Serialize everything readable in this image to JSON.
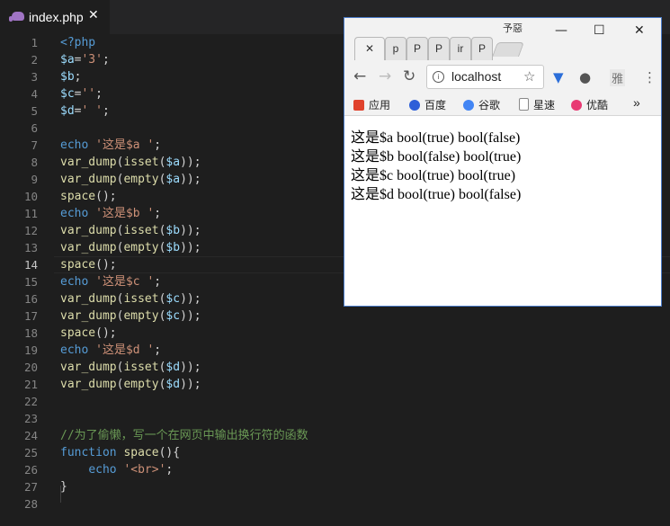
{
  "editor": {
    "tab": {
      "filename": "index.php",
      "close_glyph": "✕",
      "icon": "php-elephant-icon"
    },
    "current_line": 14,
    "lines": [
      {
        "n": "1",
        "t": [
          [
            "tag",
            "<?php"
          ]
        ]
      },
      {
        "n": "2",
        "t": [
          [
            "var",
            "$a"
          ],
          [
            "op",
            "="
          ],
          [
            "str",
            "'3'"
          ],
          [
            "op",
            ";"
          ]
        ]
      },
      {
        "n": "3",
        "t": [
          [
            "var",
            "$b"
          ],
          [
            "op",
            ";"
          ]
        ]
      },
      {
        "n": "4",
        "t": [
          [
            "var",
            "$c"
          ],
          [
            "op",
            "="
          ],
          [
            "str",
            "''"
          ],
          [
            "op",
            ";"
          ]
        ]
      },
      {
        "n": "5",
        "t": [
          [
            "var",
            "$d"
          ],
          [
            "op",
            "="
          ],
          [
            "str",
            "' '"
          ],
          [
            "op",
            ";"
          ]
        ]
      },
      {
        "n": "6",
        "t": []
      },
      {
        "n": "7",
        "t": [
          [
            "kw",
            "echo"
          ],
          [
            "plain",
            " "
          ],
          [
            "str",
            "'这是$a '"
          ],
          [
            "op",
            ";"
          ]
        ]
      },
      {
        "n": "8",
        "t": [
          [
            "fn",
            "var_dump"
          ],
          [
            "op",
            "("
          ],
          [
            "fn",
            "isset"
          ],
          [
            "op",
            "("
          ],
          [
            "var",
            "$a"
          ],
          [
            "op",
            "));"
          ]
        ]
      },
      {
        "n": "9",
        "t": [
          [
            "fn",
            "var_dump"
          ],
          [
            "op",
            "("
          ],
          [
            "fn",
            "empty"
          ],
          [
            "op",
            "("
          ],
          [
            "var",
            "$a"
          ],
          [
            "op",
            "));"
          ]
        ]
      },
      {
        "n": "10",
        "t": [
          [
            "fn",
            "space"
          ],
          [
            "op",
            "();"
          ]
        ]
      },
      {
        "n": "11",
        "t": [
          [
            "kw",
            "echo"
          ],
          [
            "plain",
            " "
          ],
          [
            "str",
            "'这是$b '"
          ],
          [
            "op",
            ";"
          ]
        ]
      },
      {
        "n": "12",
        "t": [
          [
            "fn",
            "var_dump"
          ],
          [
            "op",
            "("
          ],
          [
            "fn",
            "isset"
          ],
          [
            "op",
            "("
          ],
          [
            "var",
            "$b"
          ],
          [
            "op",
            "));"
          ]
        ]
      },
      {
        "n": "13",
        "t": [
          [
            "fn",
            "var_dump"
          ],
          [
            "op",
            "("
          ],
          [
            "fn",
            "empty"
          ],
          [
            "op",
            "("
          ],
          [
            "var",
            "$b"
          ],
          [
            "op",
            "));"
          ]
        ]
      },
      {
        "n": "14",
        "t": [
          [
            "fn",
            "space"
          ],
          [
            "op",
            "();"
          ]
        ]
      },
      {
        "n": "15",
        "t": [
          [
            "kw",
            "echo"
          ],
          [
            "plain",
            " "
          ],
          [
            "str",
            "'这是$c '"
          ],
          [
            "op",
            ";"
          ]
        ]
      },
      {
        "n": "16",
        "t": [
          [
            "fn",
            "var_dump"
          ],
          [
            "op",
            "("
          ],
          [
            "fn",
            "isset"
          ],
          [
            "op",
            "("
          ],
          [
            "var",
            "$c"
          ],
          [
            "op",
            "));"
          ]
        ]
      },
      {
        "n": "17",
        "t": [
          [
            "fn",
            "var_dump"
          ],
          [
            "op",
            "("
          ],
          [
            "fn",
            "empty"
          ],
          [
            "op",
            "("
          ],
          [
            "var",
            "$c"
          ],
          [
            "op",
            "));"
          ]
        ]
      },
      {
        "n": "18",
        "t": [
          [
            "fn",
            "space"
          ],
          [
            "op",
            "();"
          ]
        ]
      },
      {
        "n": "19",
        "t": [
          [
            "kw",
            "echo"
          ],
          [
            "plain",
            " "
          ],
          [
            "str",
            "'这是$d '"
          ],
          [
            "op",
            ";"
          ]
        ]
      },
      {
        "n": "20",
        "t": [
          [
            "fn",
            "var_dump"
          ],
          [
            "op",
            "("
          ],
          [
            "fn",
            "isset"
          ],
          [
            "op",
            "("
          ],
          [
            "var",
            "$d"
          ],
          [
            "op",
            "));"
          ]
        ]
      },
      {
        "n": "21",
        "t": [
          [
            "fn",
            "var_dump"
          ],
          [
            "op",
            "("
          ],
          [
            "fn",
            "empty"
          ],
          [
            "op",
            "("
          ],
          [
            "var",
            "$d"
          ],
          [
            "op",
            "));"
          ]
        ]
      },
      {
        "n": "22",
        "t": []
      },
      {
        "n": "23",
        "t": []
      },
      {
        "n": "24",
        "t": [
          [
            "com",
            "//为了偷懒，写一个在网页中输出换行符的函数"
          ]
        ]
      },
      {
        "n": "25",
        "t": [
          [
            "kw",
            "function"
          ],
          [
            "plain",
            " "
          ],
          [
            "fn",
            "space"
          ],
          [
            "op",
            "(){"
          ]
        ]
      },
      {
        "n": "26",
        "t": [
          [
            "plain",
            "    "
          ],
          [
            "kw",
            "echo"
          ],
          [
            "plain",
            " "
          ],
          [
            "str",
            "'<br>'"
          ],
          [
            "op",
            ";"
          ]
        ]
      },
      {
        "n": "27",
        "t": [
          [
            "op",
            "}"
          ]
        ]
      },
      {
        "n": "28",
        "t": []
      }
    ],
    "colors": {
      "tag": "#569cd6",
      "var": "#9cdcfe",
      "op": "#d4d4d4",
      "str": "#ce9178",
      "fn": "#dcdcaa",
      "kw": "#569cd6",
      "com": "#6a9955",
      "plain": "#d4d4d4"
    }
  },
  "browser": {
    "tabs": [
      "p",
      "P",
      "P",
      "ir",
      "P"
    ],
    "active_tab_close": "✕",
    "user_badge": "予惡",
    "window_controls": {
      "minimize": "—",
      "maximize": "☐",
      "close": "✕"
    },
    "nav": {
      "back": "←",
      "forward": "→",
      "reload": "↻"
    },
    "address": {
      "url": "localhost",
      "info_icon": "i",
      "star_icon": "☆"
    },
    "extensions": [
      "vivaldi-icon",
      "evernote-icon",
      "ya-icon"
    ],
    "ya_label": "雅",
    "menu_icon": "⋮",
    "bookmarks": [
      {
        "label": "应用",
        "icon": "apps-grid-icon",
        "color": "#e0422c"
      },
      {
        "label": "百度",
        "icon": "baidu-paw-icon",
        "color": "#2e5fd8"
      },
      {
        "label": "谷歌",
        "icon": "google-g-icon",
        "color": "#4285f4"
      },
      {
        "label": "星速",
        "icon": "doc-icon",
        "color": "#888888"
      },
      {
        "label": "优酷",
        "icon": "youku-icon",
        "color": "#e83a73"
      }
    ],
    "bookmarks_more": "»",
    "output": [
      "这是$a bool(true) bool(false)",
      "这是$b bool(false) bool(true)",
      "这是$c bool(true) bool(true)",
      "这是$d bool(true) bool(false)"
    ]
  }
}
